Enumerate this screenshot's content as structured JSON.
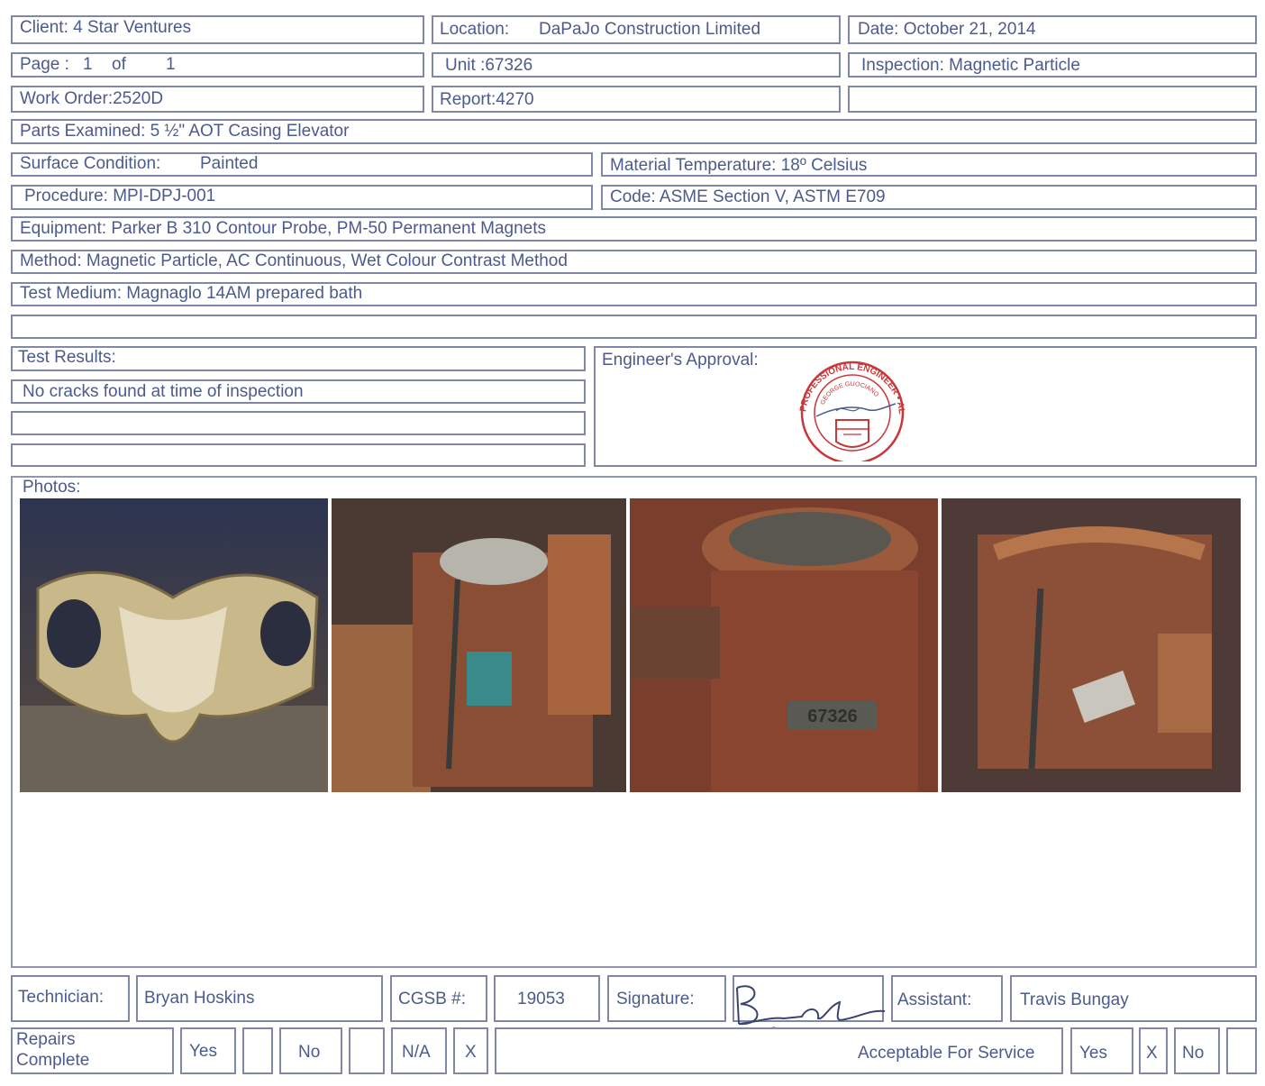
{
  "header": {
    "client": "Client:  4 Star Ventures",
    "location_label": "Location:",
    "location_value": "DaPaJo Construction Limited",
    "date": "Date: October 21, 2014",
    "page_label": "Page :",
    "page_num": "1",
    "page_of": "of",
    "page_total": "1",
    "unit": "Unit  :67326",
    "inspection": "Inspection:  Magnetic Particle",
    "work_order": "Work Order:2520D",
    "report": "Report:4270"
  },
  "details": {
    "parts_examined": "Parts Examined:  5 ½\"  AOT Casing Elevator",
    "surface_label": "Surface Condition:",
    "surface_value": "Painted",
    "material_temperature": "Material Temperature:  18º Celsius",
    "procedure": "Procedure: MPI-DPJ-001",
    "code": "Code: ASME Section V,  ASTM E709",
    "equipment": "Equipment:  Parker B 310 Contour Probe,  PM-50 Permanent Magnets",
    "method": "Method: Magnetic Particle, AC Continuous, Wet Colour Contrast Method",
    "test_medium": "Test Medium: Magnaglo 14AM prepared bath"
  },
  "results": {
    "label": "Test Results:",
    "line1": "No cracks found at time of inspection",
    "engineer_label": "Engineer's Approval:"
  },
  "stamp": {
    "ring_text": "PROFESSIONAL ENGINEER • ALBERTA",
    "name_text": "GEORGE GUOCIANO"
  },
  "photos": {
    "label": "Photos:",
    "stamp_number": "67326"
  },
  "footer": {
    "technician_label": "Technician:",
    "technician_name": "Bryan Hoskins",
    "cgsb_label": "CGSB #:",
    "cgsb_number": "19053",
    "signature_label": "Signature:",
    "assistant_label": "Assistant:",
    "assistant_name": "Travis Bungay",
    "repairs_line1": "Repairs",
    "repairs_line2": "Complete",
    "yes": "Yes",
    "no": "No",
    "na": "N/A",
    "na_mark": "X",
    "acceptable_label": "Acceptable For Service",
    "acc_yes": "Yes",
    "acc_mark": "X",
    "acc_no": "No"
  },
  "colors": {
    "ink": "#4b5b8c",
    "border": "#7f88a6",
    "stamp": "#c8373a"
  }
}
